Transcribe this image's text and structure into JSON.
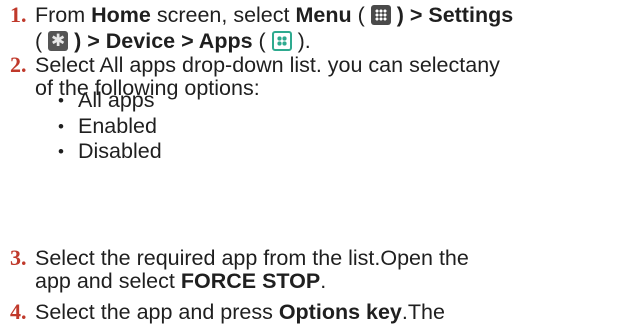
{
  "steps": [
    {
      "number": "1.",
      "line1": {
        "p1": "From ",
        "b1": "Home",
        "p2": " screen, select ",
        "b2": "Menu",
        "p3": " ( ",
        "b3": " ) > Settings"
      },
      "line2": {
        "p1": "( ",
        "b1": " ) > Device > Apps",
        "p2": " ( ",
        "p3": " )."
      }
    },
    {
      "number": "2.",
      "line1": "Select All apps drop-down list. you can selectany",
      "line2": "of the following options:",
      "options": [
        "All apps",
        "Enabled",
        "Disabled"
      ]
    },
    {
      "number": "3.",
      "line1": "Select the required app from the list.Open the",
      "line2": {
        "p1": "app and select ",
        "b1": "FORCE STOP",
        "p2": "."
      }
    },
    {
      "number": "4.",
      "line1": {
        "p1": "Select the app and press ",
        "b1": "Options key",
        "p2": ".The"
      }
    }
  ],
  "icons": {
    "menu": "menu-grid-icon",
    "settings": "settings-gear-icon",
    "apps": "apps-grid-icon"
  },
  "colors": {
    "step_number": "#c0392b",
    "text": "#1f1f1f",
    "apps_icon": "#2eaa8f"
  }
}
